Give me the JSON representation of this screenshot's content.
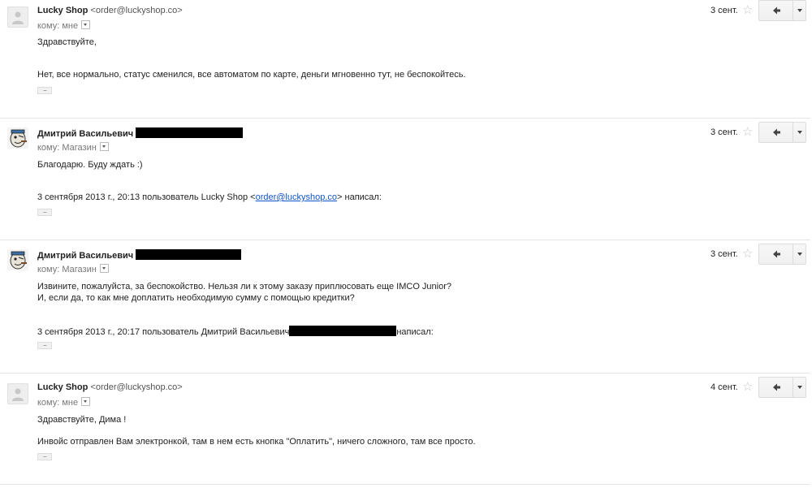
{
  "messages": [
    {
      "sender_name": "Lucky Shop",
      "sender_email": "<order@luckyshop.co>",
      "to_prefix": "кому:",
      "to_name": "мне",
      "date": "3 сент.",
      "body": [
        "Здравствуйте,",
        "Нет, все нормально, статус сменился, все автоматом по карте, деньги мгновенно тут, не беспокойтесь."
      ],
      "avatar": "generic-avatar-icon"
    },
    {
      "sender_name": "Дмитрий Васильевич",
      "to_prefix": "кому:",
      "to_name": "Магазин",
      "date": "3 сент.",
      "body": [
        "Благодарю. Буду ждать :)"
      ],
      "quote_prefix": "3 сентября 2013 г., 20:13 пользователь Lucky Shop <",
      "quote_link": "order@luckyshop.co",
      "quote_suffix": "> написал:",
      "avatar": "popeye-avatar-icon"
    },
    {
      "sender_name": "Дмитрий Васильевич",
      "to_prefix": "кому:",
      "to_name": "Магазин",
      "date": "3 сент.",
      "body": [
        "Извините, пожалуйста, за беспокойство. Нельзя ли к этому заказу приплюсовать еще IMCO Junior?",
        "И, если да, то как мне доплатить необходимую сумму с помощью кредитки?"
      ],
      "quote_prefix": "3 сентября 2013 г., 20:17 пользователь Дмитрий Васильевич",
      "quote_suffix": "написал:",
      "avatar": "popeye-avatar-icon"
    },
    {
      "sender_name": "Lucky Shop",
      "sender_email": "<order@luckyshop.co>",
      "to_prefix": "кому:",
      "to_name": "мне",
      "date": "4 сент.",
      "body": [
        "Здравствуйте, Дима !",
        "Инвойс отправлен Вам электронкой, там в нем есть кнопка \"Оплатить\", ничего сложного, там все просто."
      ],
      "avatar": "generic-avatar-icon"
    }
  ],
  "icons": {
    "star": "star-icon",
    "reply": "reply-arrow-icon",
    "more": "chevron-down-icon",
    "trimmed": "show-trimmed-content-icon"
  },
  "colors": {
    "link": "#1155cc",
    "redaction": "#000000"
  }
}
